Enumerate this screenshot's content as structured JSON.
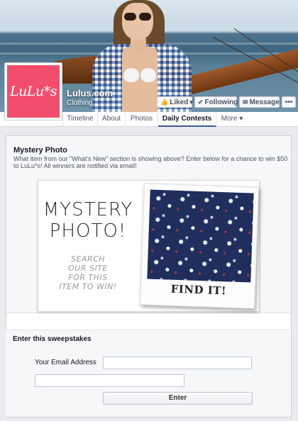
{
  "page": {
    "name": "Lulus.com",
    "category": "Clothing",
    "logo_text": "LuLu*s"
  },
  "actions": {
    "liked": "Liked",
    "following": "Following",
    "message": "Message",
    "more": "•••"
  },
  "tabs": [
    {
      "label": "Timeline"
    },
    {
      "label": "About"
    },
    {
      "label": "Photos"
    },
    {
      "label": "Daily Contests"
    },
    {
      "label": "More ▾"
    }
  ],
  "contest": {
    "title": "Mystery Photo",
    "description": "What item from our \"What's New\" section is showing above? Enter below for a chance to win $50 to LuLu*s! All winners are notified via email!",
    "image": {
      "headline_line1": "MYSTERY",
      "headline_line2": "PHOTO!",
      "sub_lines": [
        "SEARCH",
        "OUR SITE",
        "FOR THIS",
        "ITEM TO WIN!"
      ],
      "polaroid_caption": "FIND IT!"
    }
  },
  "sweepstakes": {
    "heading": "Enter this sweepstakes",
    "email_label": "Your Email Address",
    "email_value": "",
    "second_value": "",
    "submit_label": "Enter"
  },
  "colors": {
    "brand_pink": "#f04e6c",
    "facebook_blue": "#3b5998"
  }
}
